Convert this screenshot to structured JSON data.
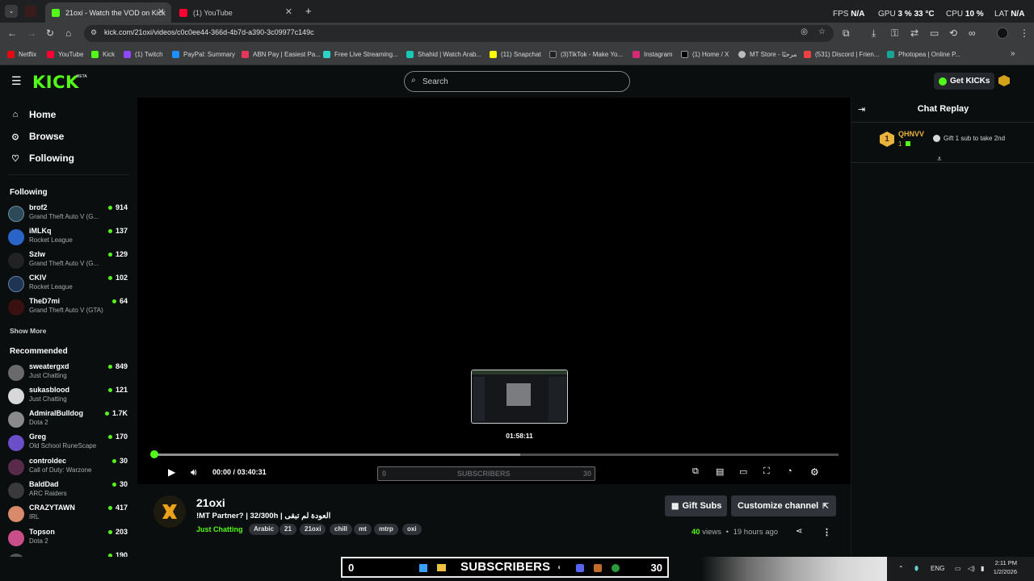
{
  "browser": {
    "tabs": [
      {
        "title": "21oxi - Watch the VOD on Kick",
        "active": true,
        "favicon_color": "#53fc18"
      },
      {
        "title": "(1) YouTube",
        "active": false,
        "favicon_color": "#ff0033"
      }
    ],
    "new_tab": "+",
    "url": "kick.com/21oxi/videos/c0c0ee44-366d-4b7d-a390-3c09977c149c",
    "overlay_stats": {
      "fps_label": "FPS",
      "fps_value": "N/A",
      "gpu_label": "GPU",
      "gpu_value": "3 %",
      "gpu_temp": "33 °C",
      "cpu_label": "CPU",
      "cpu_value": "10 %",
      "lat_label": "LAT",
      "lat_value": "N/A"
    },
    "bookmarks": [
      {
        "label": "Netflix",
        "color": "#e50914"
      },
      {
        "label": "YouTube",
        "color": "#ff0033"
      },
      {
        "label": "Kick",
        "color": "#53fc18"
      },
      {
        "label": "(1) Twitch",
        "color": "#9146ff"
      },
      {
        "label": "PayPal: Summary",
        "color": "#1e90ff"
      },
      {
        "label": "ABN Pay | Easiest Pa...",
        "color": "#e6375a"
      },
      {
        "label": "Free Live Streaming...",
        "color": "#2bd4c6"
      },
      {
        "label": "Shahid | Watch Arab...",
        "color": "#19c7b5"
      },
      {
        "label": "(11) Snapchat",
        "color": "#fffc00"
      },
      {
        "label": "(3)TikTok - Make Yo...",
        "color": "#222222"
      },
      {
        "label": "Instagram",
        "color": "#d62976"
      },
      {
        "label": "(1) Home / X",
        "color": "#000000"
      },
      {
        "label": "MT Store - مرحبًا",
        "color": "#bbbbbb"
      },
      {
        "label": "(531) Discord | Frien...",
        "color": "#ed4245"
      },
      {
        "label": "Photopea | Online P...",
        "color": "#18a497"
      }
    ]
  },
  "kick": {
    "logo": "KICK",
    "logo_badge": "BETA",
    "search_placeholder": "Search",
    "get_kicks": "Get KICKs",
    "nav": [
      {
        "label": "Home",
        "icon": "home-icon"
      },
      {
        "label": "Browse",
        "icon": "compass-icon"
      },
      {
        "label": "Following",
        "icon": "heart-icon"
      }
    ],
    "following_title": "Following",
    "following": [
      {
        "name": "brof2",
        "game": "Grand Theft Auto V (G...",
        "viewers": "914",
        "color": "#2c4a5a"
      },
      {
        "name": "iMLKq",
        "game": "Rocket League",
        "viewers": "137",
        "color": "#2a64c8"
      },
      {
        "name": "Szlw",
        "game": "Grand Theft Auto V (G...",
        "viewers": "129",
        "color": "#222222"
      },
      {
        "name": "CKIV",
        "game": "Rocket League",
        "viewers": "102",
        "color": "#1f3552"
      },
      {
        "name": "TheD7mi",
        "game": "Grand Theft Auto V (GTA)",
        "viewers": "64",
        "color": "#3a1010"
      }
    ],
    "show_more": "Show More",
    "recommended_title": "Recommended",
    "recommended": [
      {
        "name": "sweatergxd",
        "game": "Just Chatting",
        "viewers": "849",
        "color": "#6a6a6a"
      },
      {
        "name": "sukasblood",
        "game": "Just Chatting",
        "viewers": "121",
        "color": "#d8d8d8"
      },
      {
        "name": "AdmiralBulldog",
        "game": "Dota 2",
        "viewers": "1.7K",
        "color": "#8a8a8a"
      },
      {
        "name": "Greg",
        "game": "Old School RuneScape",
        "viewers": "170",
        "color": "#6b4fc9"
      },
      {
        "name": "controldec",
        "game": "Call of Duty: Warzone",
        "viewers": "30",
        "color": "#5a2a4a"
      },
      {
        "name": "BaldDad",
        "game": "ARC Raiders",
        "viewers": "30",
        "color": "#3a3a3a"
      },
      {
        "name": "CRAZYTAWN",
        "game": "IRL",
        "viewers": "417",
        "color": "#d98a6a"
      },
      {
        "name": "Topson",
        "game": "Dota 2",
        "viewers": "203",
        "color": "#c94f8a"
      }
    ],
    "partial_next_viewers": "190"
  },
  "player": {
    "preview_time": "01:58:11",
    "current_time": "00:00",
    "time_sep": "/",
    "duration": "03:40:31",
    "progress_fraction": 0.0,
    "hover_fraction": 0.535,
    "sub_goal": {
      "left": "0",
      "label": "SUBSCRIBERS",
      "right": "30"
    }
  },
  "stream": {
    "channel": "21oxi",
    "title": "!MT Partner?  | 32/300h | العودة لم تبقى",
    "category": "Just Chatting",
    "tags": [
      "Arabic",
      "21",
      "21oxi",
      "chill",
      "mt",
      "mtrp",
      "oxi"
    ],
    "gift_subs": "Gift Subs",
    "customize": "Customize channel",
    "views_count": "40",
    "views_label": "views",
    "dot": "•",
    "age": "19 hours ago"
  },
  "chat": {
    "title": "Chat Replay",
    "top_gifter": {
      "rank": "1",
      "name": "QHNVV",
      "count": "1"
    },
    "gift_cta": "Gift 1 sub to take 2nd"
  },
  "taskbar": {
    "overlay_left": "0",
    "overlay_label": "SUBSCRIBERS",
    "overlay_right": "30",
    "lang": "ENG",
    "time": "2:11 PM",
    "date": "1/2/2026"
  }
}
